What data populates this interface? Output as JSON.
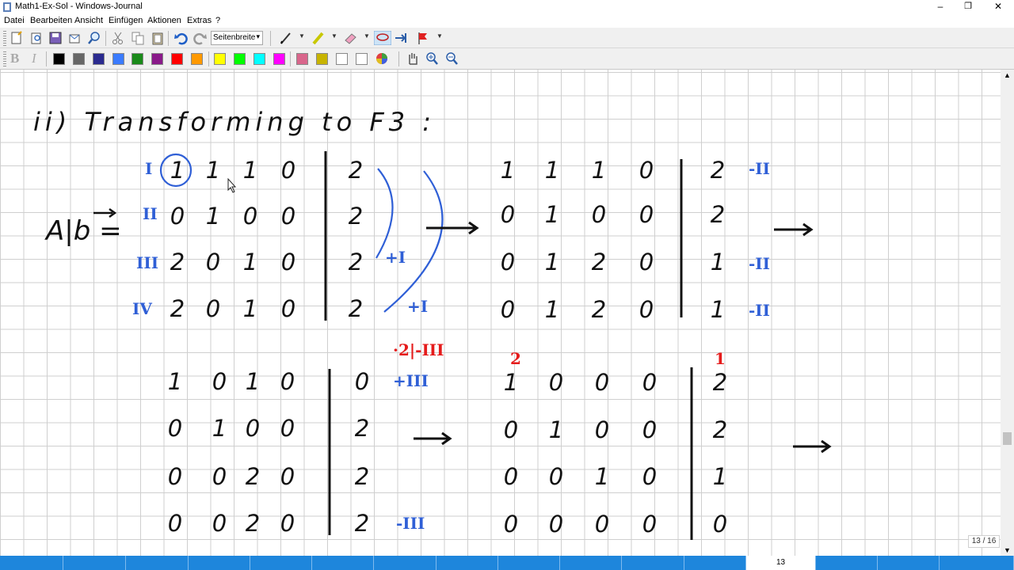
{
  "window": {
    "title": "Math1-Ex-Sol - Windows-Journal",
    "minimize_label": "–",
    "restore_label": "❐",
    "close_label": "✕"
  },
  "menu": [
    "Datei",
    "Bearbeiten",
    "Ansicht",
    "Einfügen",
    "Aktionen",
    "Extras",
    "?"
  ],
  "toolbar": {
    "zoom_value": "Seitenbreite",
    "bold_label": "B",
    "italic_label": "I",
    "colors": [
      "#000000",
      "#666666",
      "#2b2b8f",
      "#3a7bff",
      "#1a8a1a",
      "#8a1a8a",
      "#ff0000",
      "#ff9900",
      "#ffff00",
      "#00ff00",
      "#00ffff",
      "#ff00ff",
      "#d9668c",
      "#c8b400",
      "#ffffff",
      "#ffffff"
    ]
  },
  "note": {
    "heading": "ii) Transforming to F3 :",
    "label": "A|b =",
    "matrix1": {
      "rows": [
        [
          "1",
          "1",
          "1",
          "0",
          "2"
        ],
        [
          "0",
          "1",
          "0",
          "0",
          "2"
        ],
        [
          "2",
          "0",
          "1",
          "0",
          "2"
        ],
        [
          "2",
          "0",
          "1",
          "0",
          "2"
        ]
      ],
      "row_labels": [
        "I",
        "II",
        "III",
        "IV"
      ],
      "ops": [
        "+I",
        "+I"
      ]
    },
    "matrix2": {
      "rows": [
        [
          "1",
          "1",
          "1",
          "0",
          "2"
        ],
        [
          "0",
          "1",
          "0",
          "0",
          "2"
        ],
        [
          "0",
          "1",
          "2",
          "0",
          "1"
        ],
        [
          "0",
          "1",
          "2",
          "0",
          "1"
        ]
      ],
      "ops": [
        "-II",
        "-II",
        "-II"
      ]
    },
    "matrix3": {
      "rows": [
        [
          "1",
          "0",
          "1",
          "0",
          "0"
        ],
        [
          "0",
          "1",
          "0",
          "0",
          "2"
        ],
        [
          "0",
          "0",
          "2",
          "0",
          "2"
        ],
        [
          "0",
          "0",
          "2",
          "0",
          "2"
        ]
      ],
      "ops": [
        "+III",
        "-III"
      ],
      "red_note": "·2|-III"
    },
    "matrix4": {
      "rows": [
        [
          "1",
          "0",
          "0",
          "0",
          "2"
        ],
        [
          "0",
          "1",
          "0",
          "0",
          "2"
        ],
        [
          "0",
          "0",
          "1",
          "0",
          "1"
        ],
        [
          "0",
          "0",
          "0",
          "0",
          "0"
        ]
      ],
      "red_marks": [
        "2",
        "1"
      ]
    }
  },
  "pages": {
    "indicator": "13 / 16",
    "current": "13"
  }
}
